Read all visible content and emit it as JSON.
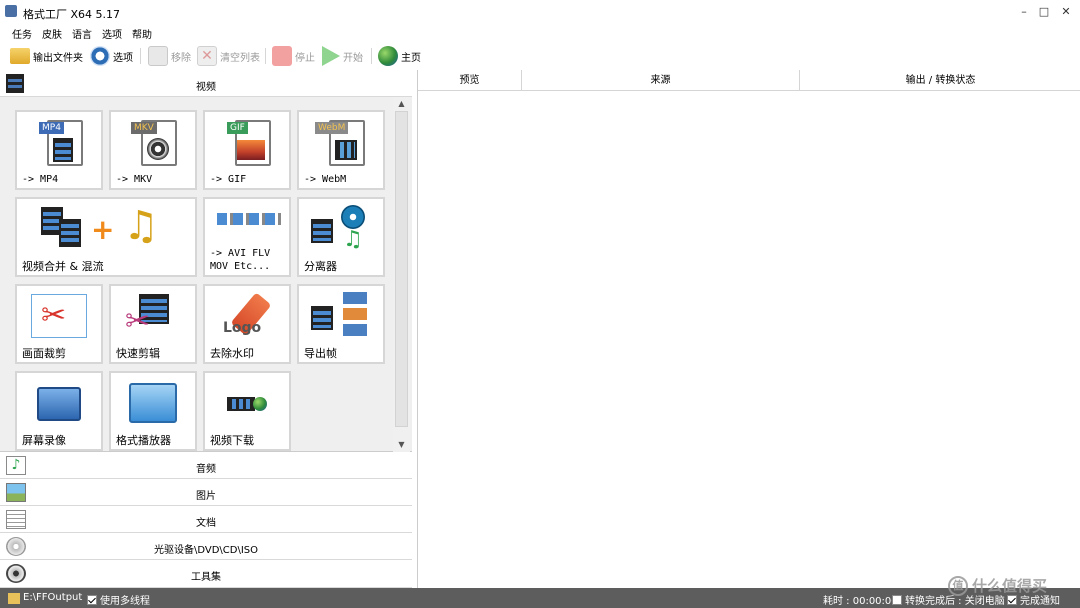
{
  "window": {
    "title": "格式工厂 X64 5.17",
    "minimize": "–",
    "maximize": "□",
    "close": "✕"
  },
  "menu": [
    "任务",
    "皮肤",
    "语言",
    "选项",
    "帮助"
  ],
  "toolbar": {
    "output_folder": "输出文件夹",
    "options": "选项",
    "remove": "移除",
    "clear_list": "清空列表",
    "stop": "停止",
    "start": "开始",
    "home": "主页"
  },
  "categories": {
    "video": "视频",
    "audio": "音频",
    "image": "图片",
    "document": "文档",
    "disc": "光驱设备\\DVD\\CD\\ISO",
    "tools": "工具集"
  },
  "video_tiles": [
    {
      "label": "-> MP4",
      "badge": "MP4",
      "badge_color": "#3e6bb5"
    },
    {
      "label": "-> MKV",
      "badge": "MKV",
      "badge_color": "#6b6b6b"
    },
    {
      "label": "-> GIF",
      "badge": "GIF",
      "badge_color": "#3a9c5a"
    },
    {
      "label": "-> WebM",
      "badge": "WebM",
      "badge_color": "#8a8a8a"
    },
    {
      "label": "视频合并 & 混流"
    },
    {
      "label": "-> AVI FLV\nMOV Etc..."
    },
    {
      "label": "分离器"
    },
    {
      "label": "画面裁剪"
    },
    {
      "label": "快速剪辑"
    },
    {
      "label": "去除水印",
      "logo_text": "Logo"
    },
    {
      "label": "导出帧"
    },
    {
      "label": "屏幕录像"
    },
    {
      "label": "格式播放器"
    },
    {
      "label": "视频下载"
    }
  ],
  "scrollbar": {
    "up": "▲",
    "down": "▼"
  },
  "table_headers": [
    "预览",
    "来源",
    "输出 / 转换状态"
  ],
  "status": {
    "output_path": "E:\\FFOutput",
    "multithread": "使用多线程",
    "multithread_checked": true,
    "elapsed": "耗时 : 00:00:00",
    "after_convert": "转换完成后 : 关闭电脑",
    "after_convert_checked": false,
    "notify": "完成通知",
    "notify_checked": true
  },
  "watermark": {
    "glyph": "值",
    "text": "什么值得买"
  },
  "colors": {
    "statusbar": "#5d5d5d",
    "tile_border": "#d6d6d6",
    "panel_bg": "#efefef"
  }
}
